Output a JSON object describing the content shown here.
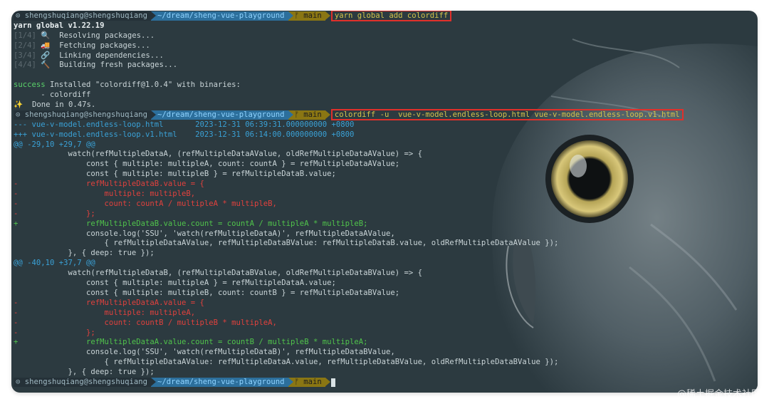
{
  "prompt": {
    "user": "⊙ shengshuqiang@shengshuqiang",
    "path": "~/dream/sheng-vue-playground",
    "branch": "ᚠ main"
  },
  "lines": [
    {
      "kind": "prompt",
      "cmd": "yarn global add colordiff",
      "boxed": true
    },
    {
      "kind": "text",
      "cls": "b",
      "text": "yarn global v1.22.19"
    },
    {
      "kind": "yarn",
      "step": "[1/4]",
      "icon": "🔍",
      "text": "  Resolving packages..."
    },
    {
      "kind": "yarn",
      "step": "[2/4]",
      "icon": "🚚",
      "text": "  Fetching packages..."
    },
    {
      "kind": "yarn",
      "step": "[3/4]",
      "icon": "🔗",
      "text": "  Linking dependencies..."
    },
    {
      "kind": "yarn",
      "step": "[4/4]",
      "icon": "🔨",
      "text": "  Building fresh packages..."
    },
    {
      "kind": "text",
      "cls": "",
      "text": ""
    },
    {
      "kind": "success",
      "label": "success",
      "text": " Installed \"colordiff@1.0.4\" with binaries:"
    },
    {
      "kind": "text",
      "cls": "",
      "text": "      - colordiff"
    },
    {
      "kind": "text",
      "cls": "",
      "text": "✨  Done in 0.47s."
    },
    {
      "kind": "prompt",
      "cmd": "colordiff -u  vue-v-model.endless-loop.html vue-v-model.endless-loop.v1.html",
      "boxed": true
    },
    {
      "kind": "text",
      "cls": "fm",
      "text": "--- vue-v-model.endless-loop.html       2023-12-31 06:39:31.000000000 +0800"
    },
    {
      "kind": "text",
      "cls": "fp",
      "text": "+++ vue-v-model.endless-loop.v1.html    2023-12-31 06:14:00.000000000 +0800"
    },
    {
      "kind": "text",
      "cls": "hh",
      "text": "@@ -29,10 +29,7 @@"
    },
    {
      "kind": "text",
      "cls": "",
      "text": "            watch(refMultipleDataA, (refMultipleDataAValue, oldRefMultipleDataAValue) => {"
    },
    {
      "kind": "text",
      "cls": "",
      "text": "                const { multiple: multipleA, count: countA } = refMultipleDataAValue;"
    },
    {
      "kind": "text",
      "cls": "",
      "text": "                const { multiple: multipleB } = refMultipleDataB.value;"
    },
    {
      "kind": "text",
      "cls": "rm",
      "text": "-               refMultipleDataB.value = {"
    },
    {
      "kind": "text",
      "cls": "rm",
      "text": "-                   multiple: multipleB,"
    },
    {
      "kind": "text",
      "cls": "rm",
      "text": "-                   count: countA / multipleA * multipleB,"
    },
    {
      "kind": "text",
      "cls": "rm",
      "text": "-               };"
    },
    {
      "kind": "text",
      "cls": "ad",
      "text": "+               refMultipleDataB.value.count = countA / multipleA * multipleB;"
    },
    {
      "kind": "text",
      "cls": "",
      "text": "                console.log('SSU', 'watch(refMultipleDataA)', refMultipleDataAValue,"
    },
    {
      "kind": "text",
      "cls": "",
      "text": "                    { refMultipleDataAValue, refMultipleDataBValue: refMultipleDataB.value, oldRefMultipleDataAValue });"
    },
    {
      "kind": "text",
      "cls": "",
      "text": "            }, { deep: true });"
    },
    {
      "kind": "text",
      "cls": "hh",
      "text": "@@ -40,10 +37,7 @@"
    },
    {
      "kind": "text",
      "cls": "",
      "text": "            watch(refMultipleDataB, (refMultipleDataBValue, oldRefMultipleDataBValue) => {"
    },
    {
      "kind": "text",
      "cls": "",
      "text": "                const { multiple: multipleA } = refMultipleDataA.value;"
    },
    {
      "kind": "text",
      "cls": "",
      "text": "                const { multiple: multipleB, count: countB } = refMultipleDataBValue;"
    },
    {
      "kind": "text",
      "cls": "rm",
      "text": "-               refMultipleDataA.value = {"
    },
    {
      "kind": "text",
      "cls": "rm",
      "text": "-                   multiple: multipleA,"
    },
    {
      "kind": "text",
      "cls": "rm",
      "text": "-                   count: countB / multipleB * multipleA,"
    },
    {
      "kind": "text",
      "cls": "rm",
      "text": "-               };"
    },
    {
      "kind": "text",
      "cls": "ad",
      "text": "+               refMultipleDataA.value.count = countB / multipleB * multipleA;"
    },
    {
      "kind": "text",
      "cls": "",
      "text": "                console.log('SSU', 'watch(refMultipleDataB)', refMultipleDataBValue,"
    },
    {
      "kind": "text",
      "cls": "",
      "text": "                    { refMultipleDataAValue: refMultipleDataA.value, refMultipleDataBValue, oldRefMultipleDataBValue });"
    },
    {
      "kind": "text",
      "cls": "",
      "text": "            }, { deep: true });"
    },
    {
      "kind": "prompt",
      "cmd": "",
      "boxed": false,
      "cursor": true
    }
  ],
  "watermark": "@稀土掘金技术社区",
  "colors": {
    "terminal_bg": "#2c3a40",
    "removed": "#e0413d",
    "added": "#50c34b",
    "hunk": "#3aa1d6",
    "command": "#d4c34a",
    "highlight_box": "#e0302b"
  },
  "background_image": "owl-icon"
}
